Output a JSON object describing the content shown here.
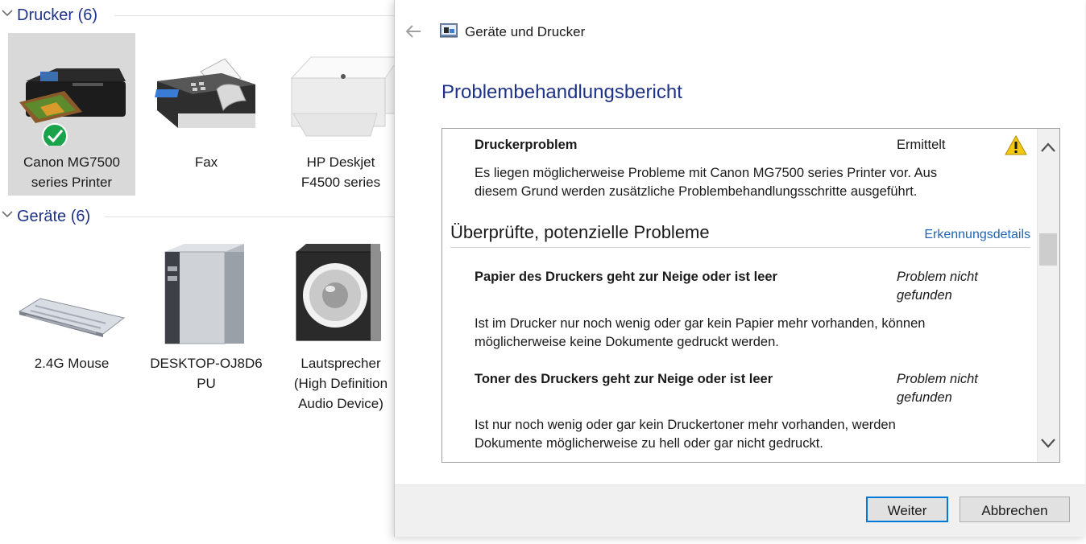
{
  "printers_group": {
    "title": "Drucker (6)"
  },
  "printers": [
    {
      "name": "Canon MG7500 series Printer",
      "line1": "Canon MG7500",
      "line2": "series Printer",
      "selected": true,
      "default": true
    },
    {
      "name": "Fax",
      "line1": "Fax",
      "line2": ""
    },
    {
      "name": "HP Deskjet F4500 series",
      "line1": "HP Deskjet",
      "line2": "F4500 series"
    }
  ],
  "devices_group": {
    "title": "Geräte (6)"
  },
  "devices": [
    {
      "line1": "2.4G Mouse",
      "line2": "",
      "line3": ""
    },
    {
      "line1": "DESKTOP-OJ8D6",
      "line2": "PU",
      "line3": ""
    },
    {
      "line1": "Lautsprecher",
      "line2": "(High Definition",
      "line3": "Audio Device)"
    }
  ],
  "dialog": {
    "app_title": "Geräte und Drucker",
    "heading": "Problembehandlungsbericht",
    "report": {
      "problem_title": "Druckerproblem",
      "problem_status": "Ermittelt",
      "problem_desc_1": "Es liegen möglicherweise Probleme mit Canon MG7500 series Printer vor. Aus",
      "problem_desc_2": "diesem Grund werden zusätzliche Problembehandlungsschritte ausgeführt.",
      "checked_title": "Überprüfte, potenzielle Probleme",
      "details_link": "Erkennungsdetails",
      "issues": [
        {
          "title": "Papier des Druckers geht zur Neige oder ist leer",
          "status_1": "Problem nicht",
          "status_2": "gefunden",
          "desc_1": "Ist im Drucker nur noch wenig oder gar kein Papier mehr vorhanden, können",
          "desc_2": "möglicherweise keine Dokumente gedruckt werden."
        },
        {
          "title": "Toner des Druckers geht zur Neige oder ist leer",
          "status_1": "Problem nicht",
          "status_2": "gefunden",
          "desc_1": "Ist nur noch wenig oder gar kein Druckertoner mehr vorhanden, werden",
          "desc_2": "Dokumente möglicherweise zu hell oder gar nicht gedruckt."
        }
      ]
    },
    "buttons": {
      "next": "Weiter",
      "cancel": "Abbrechen"
    }
  },
  "colors": {
    "accent": "#1e3287",
    "link": "#1e64b4",
    "success": "#1aa34a",
    "warning": "#f2c811"
  }
}
